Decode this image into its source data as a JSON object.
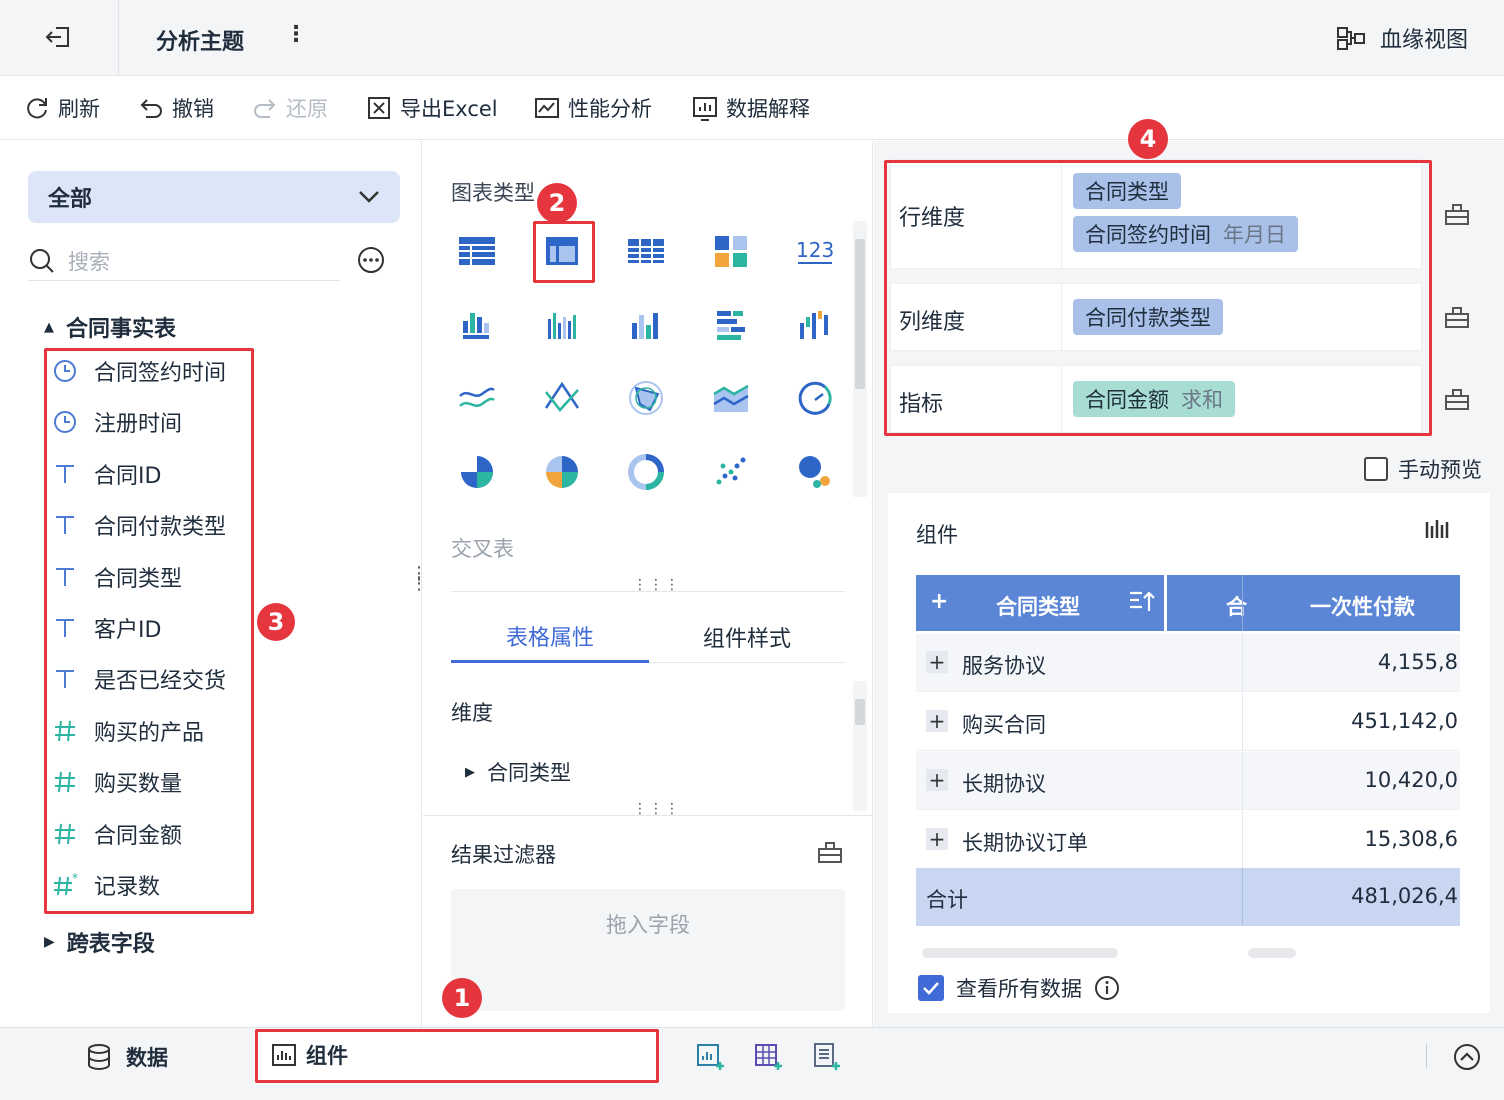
{
  "header": {
    "title": "分析主题",
    "lineage": "血缘视图"
  },
  "toolbar": {
    "refresh": "刷新",
    "undo": "撤销",
    "redo": "还原",
    "export": "导出Excel",
    "perf": "性能分析",
    "explain": "数据解释"
  },
  "left": {
    "dropdown": "全部",
    "search_placeholder": "搜索",
    "table_name": "合同事实表",
    "fields": [
      {
        "label": "合同签约时间",
        "type": "clock-icon"
      },
      {
        "label": "注册时间",
        "type": "clock-icon"
      },
      {
        "label": "合同ID",
        "type": "text-icon"
      },
      {
        "label": "合同付款类型",
        "type": "text-icon"
      },
      {
        "label": "合同类型",
        "type": "text-icon"
      },
      {
        "label": "客户ID",
        "type": "text-icon"
      },
      {
        "label": "是否已经交货",
        "type": "text-icon"
      },
      {
        "label": "购买的产品",
        "type": "number-icon"
      },
      {
        "label": "购买数量",
        "type": "number-icon"
      },
      {
        "label": "合同金额",
        "type": "number-icon"
      },
      {
        "label": "记录数",
        "type": "count-icon"
      }
    ],
    "cross_table": "跨表字段"
  },
  "middle": {
    "chart_type_label": "图表类型",
    "selected_chart_name": "交叉表",
    "tab_table_props": "表格属性",
    "tab_component_style": "组件样式",
    "dimension_label": "维度",
    "dimension_item": "合同类型",
    "result_filter": "结果过滤器",
    "drop_field": "拖入字段"
  },
  "right": {
    "row_dim": "行维度",
    "col_dim": "列维度",
    "metric": "指标",
    "row_pill_1": "合同类型",
    "row_pill_2": "合同签约时间",
    "row_pill_2_sub": "年月日",
    "col_pill": "合同付款类型",
    "metric_pill": "合同金额",
    "metric_pill_sub": "求和",
    "manual_preview": "手动预览",
    "component_title": "组件",
    "table": {
      "header_plus": "+",
      "header_col1": "合同类型",
      "header_col2_partial": "合",
      "header_col3": "一次性付款",
      "rows": [
        {
          "name": "服务协议",
          "value": "4,155,8"
        },
        {
          "name": "购买合同",
          "value": "451,142,0"
        },
        {
          "name": "长期协议",
          "value": "10,420,0"
        },
        {
          "name": "长期协议订单",
          "value": "15,308,6"
        }
      ],
      "total_label": "合计",
      "total_value": "481,026,4"
    },
    "view_all": "查看所有数据"
  },
  "bottom": {
    "data_tab": "数据",
    "component_tab": "组件"
  },
  "badges": {
    "b1": "1",
    "b2": "2",
    "b3": "3",
    "b4": "4"
  },
  "colors": {
    "accent": "#3f6ad8",
    "red": "#e5353d",
    "pill_blue": "#a9c0e8",
    "pill_green": "#a7ddd3",
    "table_header": "#5b86d6"
  }
}
